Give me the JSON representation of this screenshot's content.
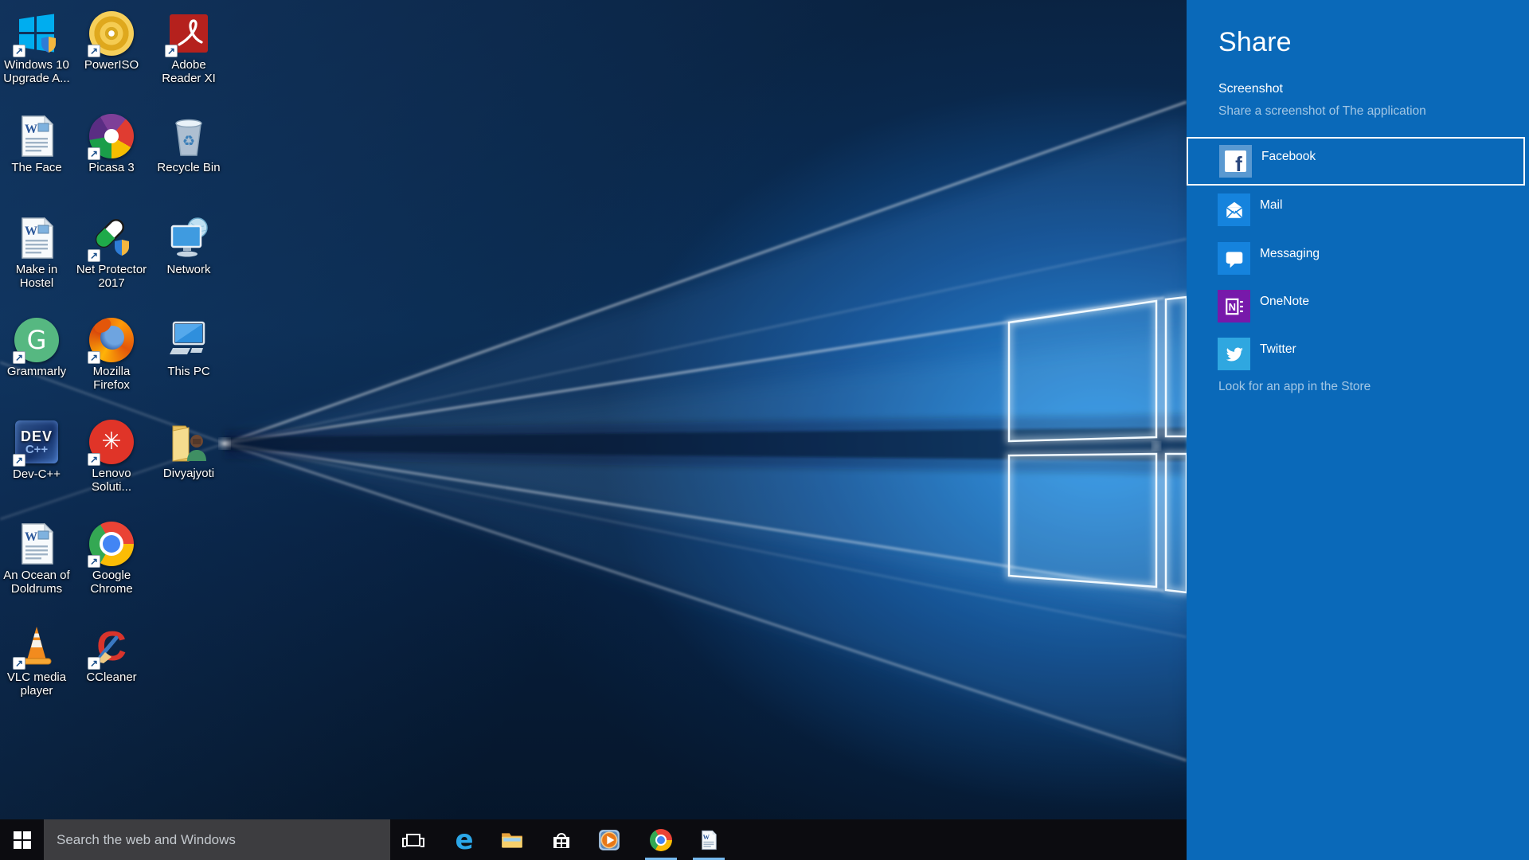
{
  "colors": {
    "share_panel": "#0a69b9",
    "accent_tile": "#1583dd",
    "onenote_tile": "#7719aa",
    "twitter_tile": "#2fa7e0",
    "taskbar": "#0c0c10",
    "search_box": "#3d3d40",
    "running_indicator": "#76b9ed",
    "wallpaper_bright_blue": "#1b87e2",
    "wallpaper_dark_navy": "#071d3a"
  },
  "desktop": {
    "icons": [
      {
        "id": "windows-10-upgrade",
        "label": "Windows 10\nUpgrade A...",
        "icon": "windows-upgrade-icon",
        "col": 0,
        "row": 0,
        "shortcut": true
      },
      {
        "id": "poweriso",
        "label": "PowerISO",
        "icon": "poweriso-icon",
        "col": 1,
        "row": 0,
        "shortcut": true
      },
      {
        "id": "adobe-reader-xi",
        "label": "Adobe\nReader XI",
        "icon": "adobe-reader-icon",
        "col": 2,
        "row": 0,
        "shortcut": true
      },
      {
        "id": "the-face",
        "label": "The Face",
        "icon": "word-document-icon",
        "col": 0,
        "row": 1,
        "shortcut": false
      },
      {
        "id": "picasa-3",
        "label": "Picasa 3",
        "icon": "picasa-icon",
        "col": 1,
        "row": 1,
        "shortcut": true
      },
      {
        "id": "recycle-bin",
        "label": "Recycle Bin",
        "icon": "recycle-bin-icon",
        "col": 2,
        "row": 1,
        "shortcut": false
      },
      {
        "id": "make-in-hostel",
        "label": "Make in\nHostel",
        "icon": "word-document-icon",
        "col": 0,
        "row": 2,
        "shortcut": false
      },
      {
        "id": "net-protector-2017",
        "label": "Net Protector\n2017",
        "icon": "net-protector-icon",
        "col": 1,
        "row": 2,
        "shortcut": true
      },
      {
        "id": "network",
        "label": "Network",
        "icon": "network-icon",
        "col": 2,
        "row": 2,
        "shortcut": false
      },
      {
        "id": "grammarly",
        "label": "Grammarly",
        "icon": "grammarly-icon",
        "col": 0,
        "row": 3,
        "shortcut": true
      },
      {
        "id": "mozilla-firefox",
        "label": "Mozilla\nFirefox",
        "icon": "firefox-icon",
        "col": 1,
        "row": 3,
        "shortcut": true
      },
      {
        "id": "this-pc",
        "label": "This PC",
        "icon": "this-pc-icon",
        "col": 2,
        "row": 3,
        "shortcut": false
      },
      {
        "id": "dev-cpp",
        "label": "Dev-C++",
        "icon": "dev-cpp-icon",
        "col": 0,
        "row": 4,
        "shortcut": true
      },
      {
        "id": "lenovo-solutions",
        "label": "Lenovo\nSoluti...",
        "icon": "lenovo-icon",
        "col": 1,
        "row": 4,
        "shortcut": true
      },
      {
        "id": "divyajyoti",
        "label": "Divyajyoti",
        "icon": "user-folder-icon",
        "col": 2,
        "row": 4,
        "shortcut": false
      },
      {
        "id": "an-ocean-of-doldrums",
        "label": "An Ocean of\nDoldrums",
        "icon": "word-document-icon",
        "col": 0,
        "row": 5,
        "shortcut": false
      },
      {
        "id": "google-chrome",
        "label": "Google\nChrome",
        "icon": "chrome-icon",
        "col": 1,
        "row": 5,
        "shortcut": true
      },
      {
        "id": "vlc-media-player",
        "label": "VLC media\nplayer",
        "icon": "vlc-icon",
        "col": 0,
        "row": 6,
        "shortcut": true
      },
      {
        "id": "ccleaner",
        "label": "CCleaner",
        "icon": "ccleaner-icon",
        "col": 1,
        "row": 6,
        "shortcut": true
      }
    ]
  },
  "share": {
    "title": "Share",
    "item_title": "Screenshot",
    "item_description": "Share a screenshot of The application",
    "store_link": "Look for an app in the Store",
    "targets": [
      {
        "label": "Facebook",
        "icon": "facebook-icon",
        "selected": true
      },
      {
        "label": "Mail",
        "icon": "mail-icon",
        "selected": false
      },
      {
        "label": "Messaging",
        "icon": "messaging-icon",
        "selected": false
      },
      {
        "label": "OneNote",
        "icon": "onenote-icon",
        "selected": false
      },
      {
        "label": "Twitter",
        "icon": "twitter-icon",
        "selected": false
      }
    ]
  },
  "taskbar": {
    "search_placeholder": "Search the web and Windows",
    "apps": [
      {
        "id": "edge",
        "icon": "edge-icon",
        "running": false
      },
      {
        "id": "file-explorer",
        "icon": "file-explorer-icon",
        "running": false
      },
      {
        "id": "store",
        "icon": "store-icon",
        "running": false
      },
      {
        "id": "media-player",
        "icon": "media-player-icon",
        "running": false
      },
      {
        "id": "chrome",
        "icon": "chrome-small-icon",
        "running": true
      },
      {
        "id": "word",
        "icon": "word-small-icon",
        "running": true
      }
    ]
  }
}
